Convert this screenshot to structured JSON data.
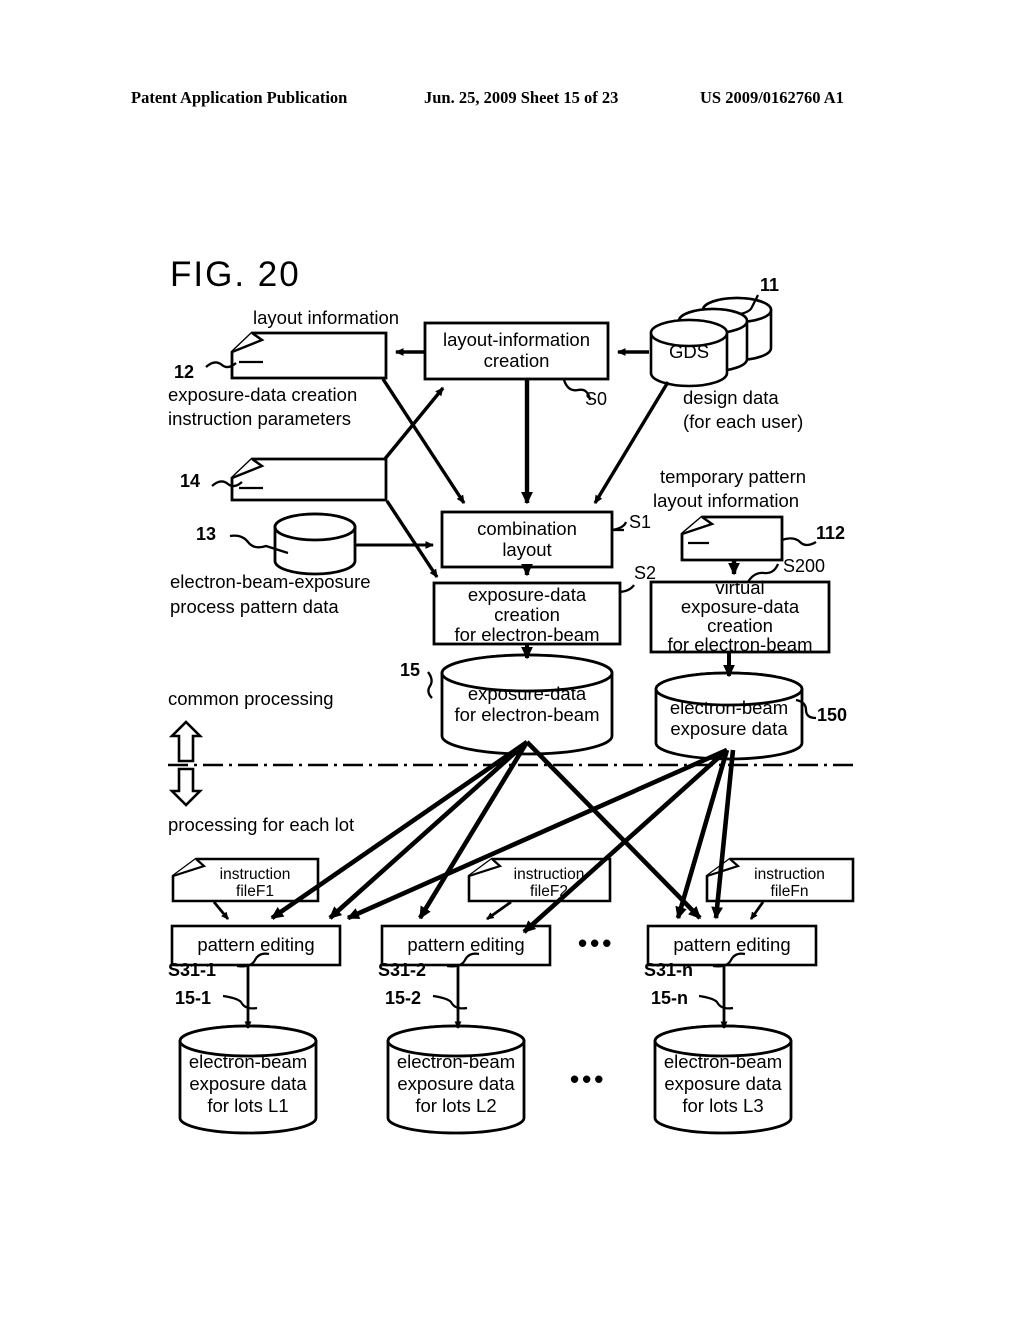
{
  "header": {
    "publication": "Patent Application Publication",
    "date_sheet": "Jun. 25, 2009  Sheet 15 of 23",
    "patent_number": "US 2009/0162760 A1"
  },
  "figure": {
    "label": "FIG. 20"
  },
  "labels": {
    "layout_information": "layout information",
    "exposure_data_creation_instruction_parameters_l1": "exposure-data creation",
    "exposure_data_creation_instruction_parameters_l2": "instruction parameters",
    "eb_exposure_process_pattern_data_l1": "electron-beam-exposure",
    "eb_exposure_process_pattern_data_l2": "process pattern data",
    "design_data_l1": "design data",
    "design_data_l2": "(for each user)",
    "temporary_pattern_l1": "temporary pattern",
    "temporary_pattern_l2": "layout information",
    "common_processing": "common processing",
    "processing_for_each_lot": "processing for each lot",
    "ellipsis": "•••"
  },
  "refnums": {
    "n11": "11",
    "n12": "12",
    "n13": "13",
    "n14": "14",
    "n15": "15",
    "n112": "112",
    "n150": "150",
    "n15_1": "15-1",
    "n15_2": "15-2",
    "n15_n": "15-n"
  },
  "steps": {
    "s0": "S0",
    "s1": "S1",
    "s2": "S2",
    "s200": "S200",
    "s31_1": "S31-1",
    "s31_2": "S31-2",
    "s31_n": "S31-n"
  },
  "boxes": {
    "layout_information_creation": {
      "line1": "layout-information",
      "line2": "creation"
    },
    "combination_layout": {
      "line1": "combination",
      "line2": "layout"
    },
    "exposure_data_creation_eb": {
      "line1": "exposure-data",
      "line2": "creation",
      "line3": "for electron-beam"
    },
    "virtual_exposure_data_creation_eb": {
      "line1": "virtual",
      "line2": "exposure-data",
      "line3": "creation",
      "line4": "for electron-beam"
    },
    "pattern_editing_1": "pattern editing",
    "pattern_editing_2": "pattern editing",
    "pattern_editing_n": "pattern editing"
  },
  "documents": {
    "doc12": "",
    "doc14": "",
    "doc112": "",
    "instruction_file_1": {
      "line1": "instruction",
      "line2": "fileF1"
    },
    "instruction_file_2": {
      "line1": "instruction",
      "line2": "fileF2"
    },
    "instruction_file_n": {
      "line1": "instruction",
      "line2": "fileFn"
    }
  },
  "cylinders": {
    "gds": "GDS",
    "eb_pattern_data": "",
    "exposure_data_for_eb": {
      "line1": "exposure-data",
      "line2": "for electron-beam"
    },
    "eb_exposure_data": {
      "line1": "electron-beam",
      "line2": "exposure data"
    },
    "lot_l1": {
      "line1": "electron-beam",
      "line2": "exposure data",
      "line3": "for lots L1"
    },
    "lot_l2": {
      "line1": "electron-beam",
      "line2": "exposure data",
      "line3": "for lots L2"
    },
    "lot_l3": {
      "line1": "electron-beam",
      "line2": "exposure data",
      "line3": "for lots L3"
    }
  },
  "colors": {
    "ink": "#000000",
    "paper": "#ffffff"
  }
}
